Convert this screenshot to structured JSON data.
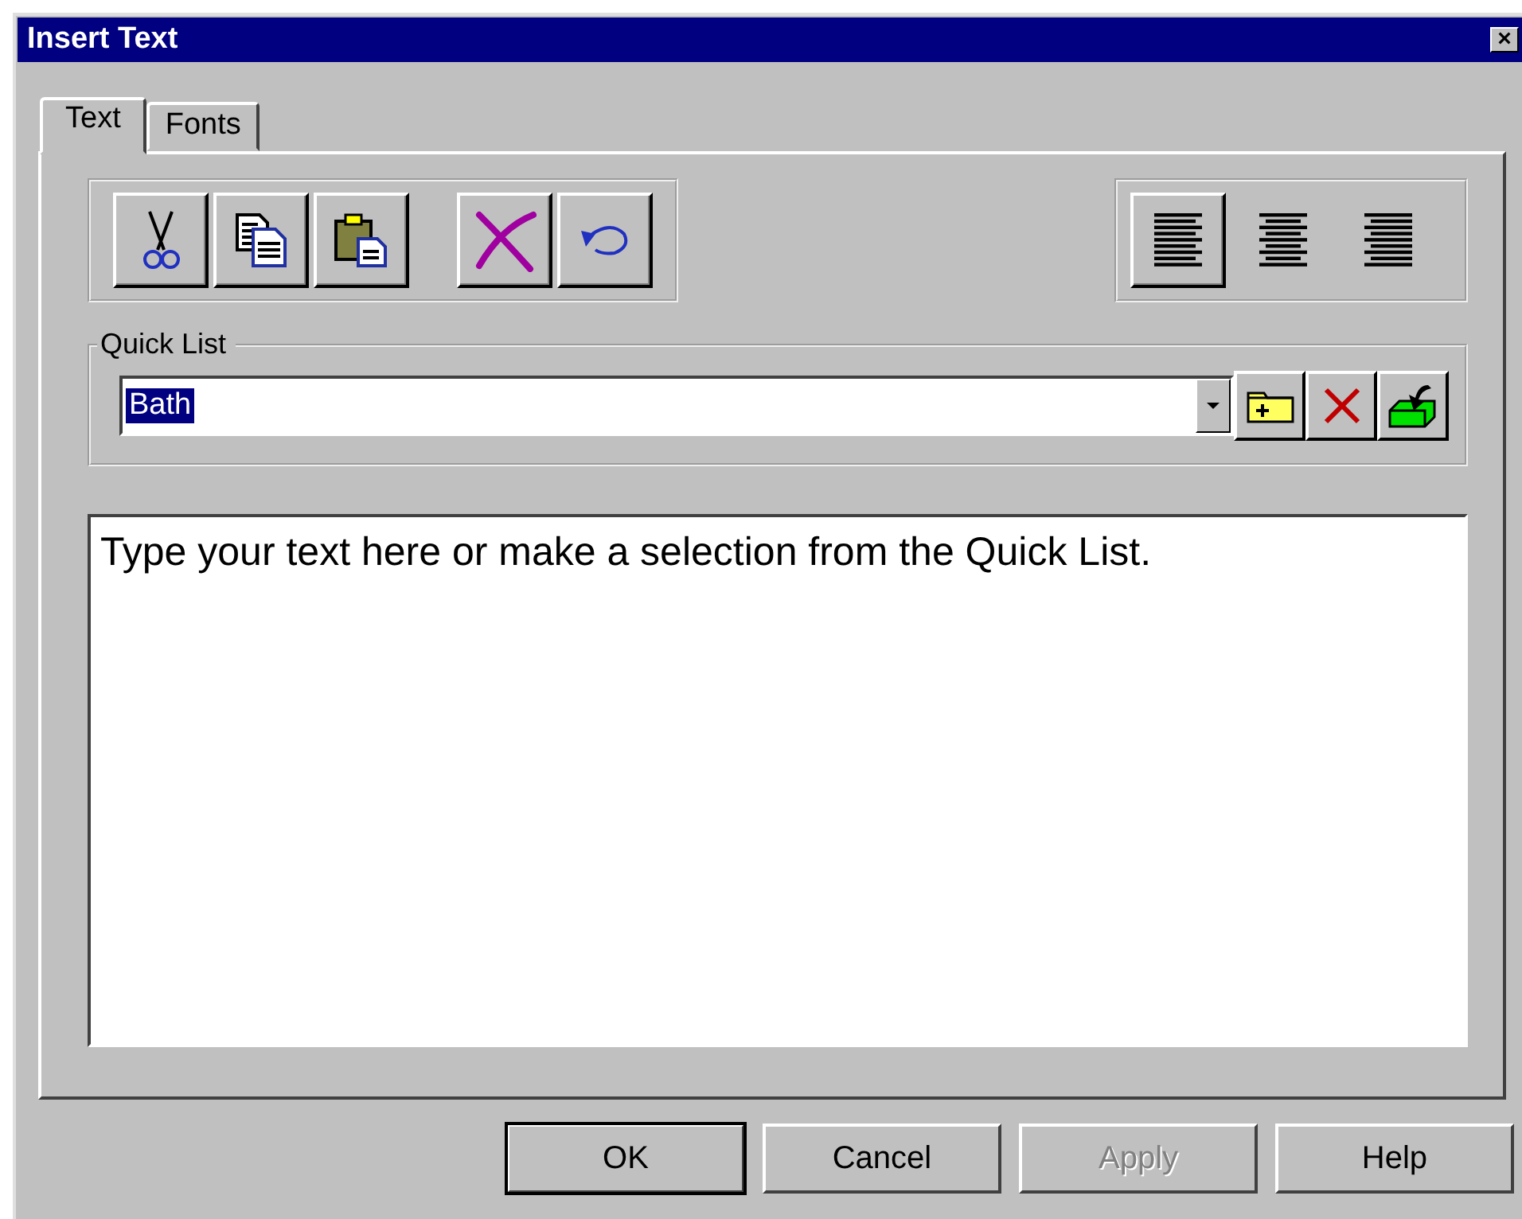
{
  "window": {
    "title": "Insert Text",
    "close": "×"
  },
  "tabs": [
    {
      "label": "Text",
      "selected": true
    },
    {
      "label": "Fonts",
      "selected": false
    }
  ],
  "alignment": [
    {
      "kind": "left",
      "selected": true
    },
    {
      "kind": "center",
      "selected": false
    },
    {
      "kind": "right",
      "selected": false
    }
  ],
  "quick_list": {
    "label": "Quick List",
    "value": "Bath",
    "selected": true
  },
  "text_area": {
    "value": "Type your text here or make a selection from the Quick List."
  },
  "buttons": [
    {
      "label": "OK",
      "default": true,
      "disabled": false
    },
    {
      "label": "Cancel",
      "default": false,
      "disabled": false
    },
    {
      "label": "Apply",
      "default": false,
      "disabled": true
    },
    {
      "label": "Help",
      "default": false,
      "disabled": false
    }
  ]
}
